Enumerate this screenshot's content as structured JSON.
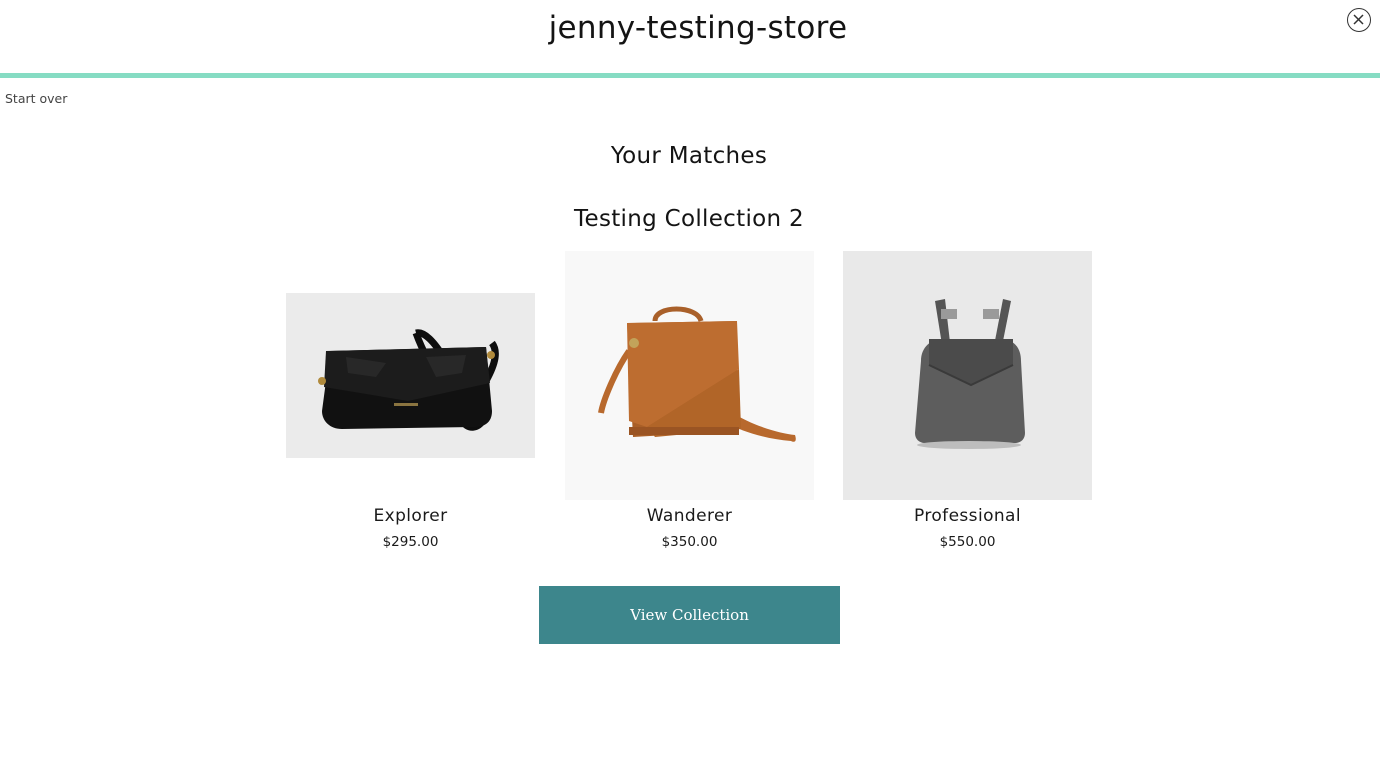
{
  "header": {
    "store_title": "jenny-testing-store",
    "close_icon": "close-circle-icon",
    "progress_percent": 100,
    "progress_color": "#86dcc3"
  },
  "nav": {
    "start_over_label": "Start over"
  },
  "results": {
    "heading": "Your Matches",
    "collection_title": "Testing Collection 2",
    "products": [
      {
        "name": "Explorer",
        "price": "$295.00",
        "image": "black-leather-crossbody-bag-image"
      },
      {
        "name": "Wanderer",
        "price": "$350.00",
        "image": "tan-leather-messenger-bag-image"
      },
      {
        "name": "Professional",
        "price": "$550.00",
        "image": "grey-leather-backpack-image"
      }
    ],
    "cta_label": "View Collection",
    "cta_color": "#3d868c"
  }
}
